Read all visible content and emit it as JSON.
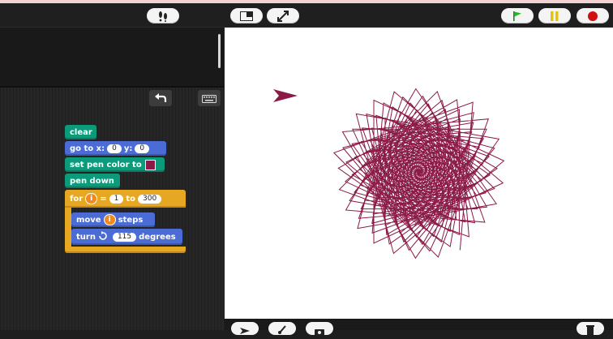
{
  "toolbar": {
    "buttons": [
      {
        "icon": "footprints-icon"
      },
      {
        "icon": "stage-size-icon"
      },
      {
        "icon": "fullscreen-icon"
      },
      {
        "icon": "green-flag-icon"
      },
      {
        "icon": "pause-icon"
      },
      {
        "icon": "stop-icon"
      }
    ]
  },
  "script": {
    "clear": "clear",
    "goto_label": "go to x:",
    "goto_x": "0",
    "goto_y_label": "y:",
    "goto_y": "0",
    "pencolor_label": "set pen color to",
    "pen_color": "#8b1a47",
    "pendown": "pen down",
    "for_label": "for",
    "for_var": "i",
    "for_eq": "=",
    "for_from": "1",
    "for_to_label": "to",
    "for_to": "300",
    "move_label": "move",
    "move_var": "i",
    "move_steps": "steps",
    "turn_label": "turn",
    "turn_value": "115",
    "turn_degrees": "degrees"
  },
  "stage": {
    "pen_color": "#8b1a47",
    "sprite_color": "#8b1a47"
  },
  "bottom": {
    "buttons": [
      {
        "icon": "turtle-icon"
      },
      {
        "icon": "paintbrush-icon"
      },
      {
        "icon": "camera-icon"
      },
      {
        "icon": "trash-icon"
      }
    ]
  }
}
